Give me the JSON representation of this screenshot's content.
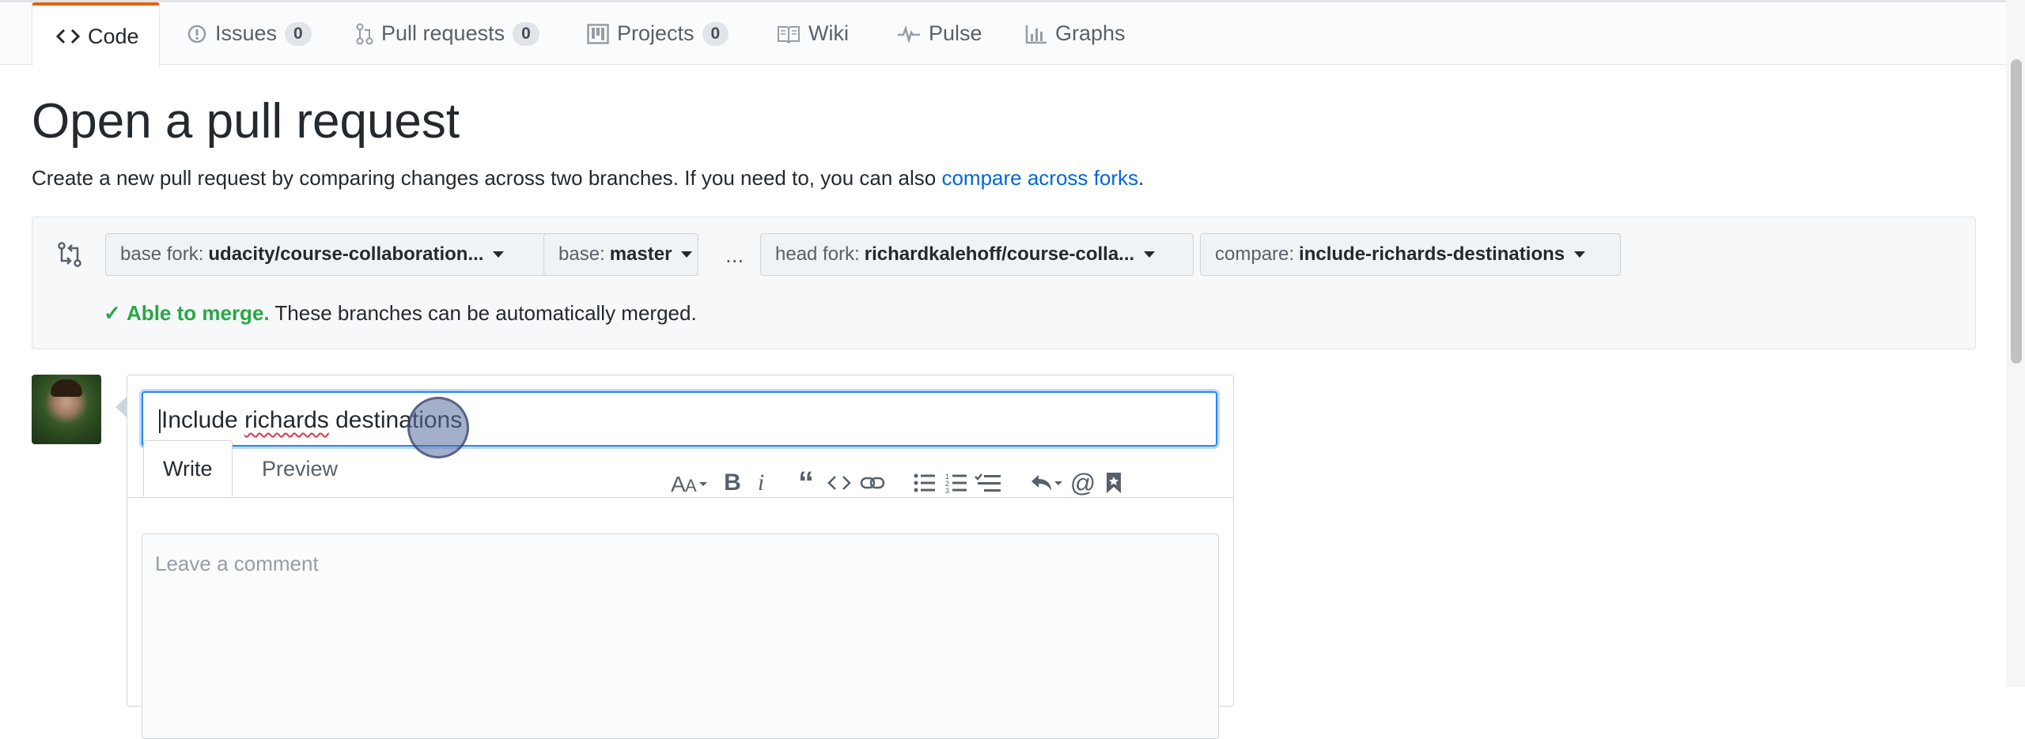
{
  "nav": {
    "tabs": [
      {
        "label": "Code",
        "icon": "code-icon"
      },
      {
        "label": "Issues",
        "count": "0",
        "icon": "issue-icon"
      },
      {
        "label": "Pull requests",
        "count": "0",
        "icon": "pull-request-icon"
      },
      {
        "label": "Projects",
        "count": "0",
        "icon": "project-icon"
      },
      {
        "label": "Wiki",
        "icon": "book-icon"
      },
      {
        "label": "Pulse",
        "icon": "pulse-icon"
      },
      {
        "label": "Graphs",
        "icon": "graph-icon"
      }
    ]
  },
  "page": {
    "title": "Open a pull request",
    "subtitle": "Create a new pull request by comparing changes across two branches. If you need to, you can also",
    "subtitle_link": "compare across forks",
    "subtitle_end": "."
  },
  "compare": {
    "base_fork_label": "base fork:",
    "base_fork_value": "udacity/course-collaboration...",
    "base_label": "base:",
    "base_value": "master",
    "dots": "...",
    "head_fork_label": "head fork:",
    "head_fork_value": "richardkalehoff/course-colla...",
    "compare_label": "compare:",
    "compare_value": "include-richards-destinations",
    "merge_ok": "Able to merge.",
    "merge_text": "These branches can be automatically merged."
  },
  "form": {
    "title_value_a": "Include ",
    "title_value_b": "richards",
    "title_value_c": " destinations",
    "write_tab": "Write",
    "preview_tab": "Preview",
    "comment_placeholder": "Leave a comment"
  },
  "toolbar_icons": [
    "text-size-icon",
    "bold-icon",
    "italic-icon",
    "quote-icon",
    "code-icon",
    "link-icon",
    "unordered-list-icon",
    "ordered-list-icon",
    "task-list-icon",
    "reply-icon",
    "mention-icon",
    "bookmark-icon"
  ],
  "colors": {
    "accent": "#e36209",
    "link": "#0366d6",
    "success": "#28a745",
    "focus": "#2188ff"
  }
}
